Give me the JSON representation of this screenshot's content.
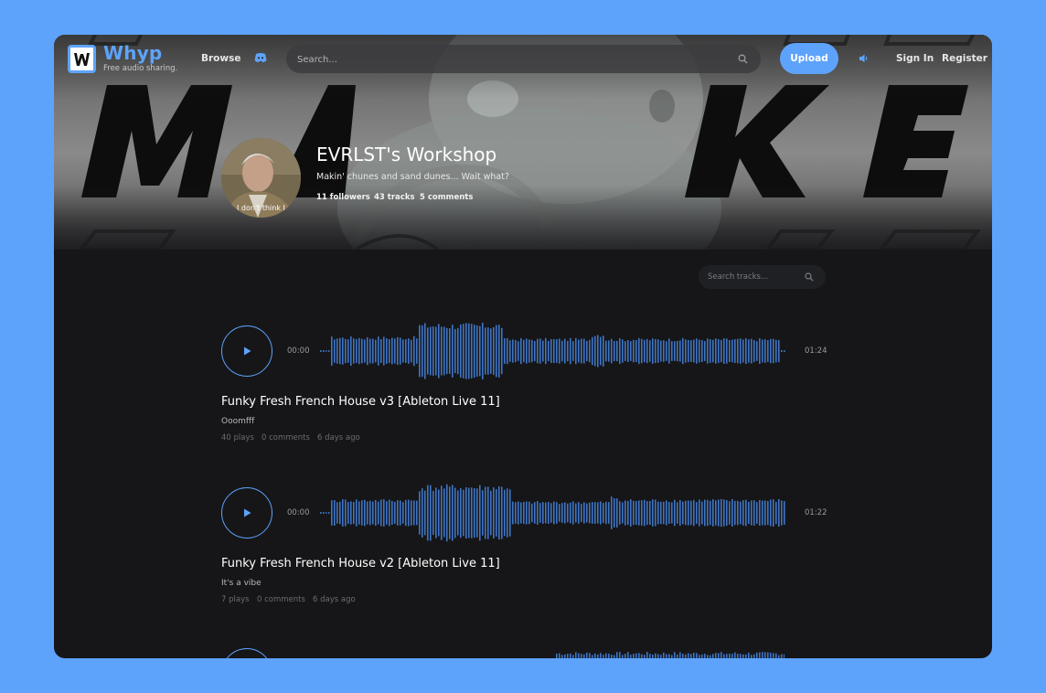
{
  "brand": {
    "name": "Whyp",
    "tagline": "Free audio sharing.",
    "accent": "#5ea3fb"
  },
  "nav": {
    "browse": "Browse",
    "search_placeholder": "Search...",
    "upload": "Upload",
    "sign_in": "Sign In",
    "register": "Register",
    "icons": [
      "discord-icon",
      "search-icon",
      "volume-icon"
    ]
  },
  "profile": {
    "name": "EVRLST's Workshop",
    "bio": "Makin' chunes and sand dunes... Wait what?",
    "avatar_caption": "I don't think I",
    "stats": {
      "followers": "11 followers",
      "tracks": "43 tracks",
      "comments": "5 comments"
    }
  },
  "track_search_placeholder": "Search tracks...",
  "tracks": [
    {
      "title": "Funky Fresh French House v3 [Ableton Live 11]",
      "description": "Ooomfff",
      "time_current": "00:00",
      "duration": "01:24",
      "plays": "40 plays",
      "comments": "0 comments",
      "age": "6 days ago"
    },
    {
      "title": "Funky Fresh French House v2 [Ableton Live 11]",
      "description": "It's a vibe",
      "time_current": "00:00",
      "duration": "01:22",
      "plays": "7 plays",
      "comments": "0 comments",
      "age": "6 days ago"
    }
  ]
}
